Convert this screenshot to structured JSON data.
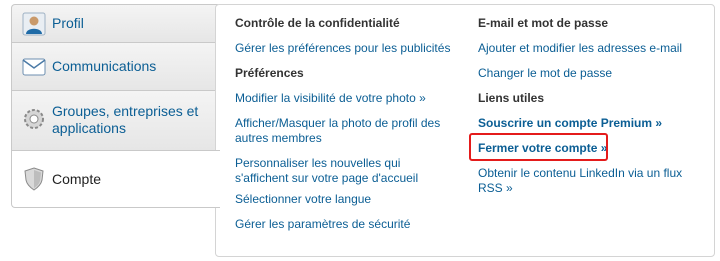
{
  "sidebar": {
    "tabs": [
      {
        "label": "Profil",
        "icon": "user-icon"
      },
      {
        "label": "Communications",
        "icon": "envelope-icon"
      },
      {
        "label": "Groupes, entreprises et applications",
        "icon": "gear-icon"
      },
      {
        "label": "Compte",
        "icon": "shield-icon",
        "active": true
      }
    ]
  },
  "left_col": {
    "h1": "Contrôle de la confidentialité",
    "l1": "Gérer les préférences pour les publicités",
    "h2": "Préférences",
    "l2": "Modifier la visibilité de votre photo »",
    "l3": "Afficher/Masquer la photo de profil des autres membres",
    "l4": "Personnaliser les nouvelles qui s'affichent sur votre page d'accueil",
    "l5": "Sélectionner votre langue",
    "l6": "Gérer les paramètres de sécurité"
  },
  "right_col": {
    "h1": "E-mail et mot de passe",
    "l1": "Ajouter et modifier les adresses e-mail",
    "l2": "Changer le mot de passe",
    "h2": "Liens utiles",
    "l3": "Souscrire un compte Premium »",
    "l4": "Fermer votre compte »",
    "l5": "Obtenir le contenu LinkedIn via un flux RSS »"
  },
  "colors": {
    "link": "#0b5e94",
    "highlight": "#e41b1b"
  }
}
